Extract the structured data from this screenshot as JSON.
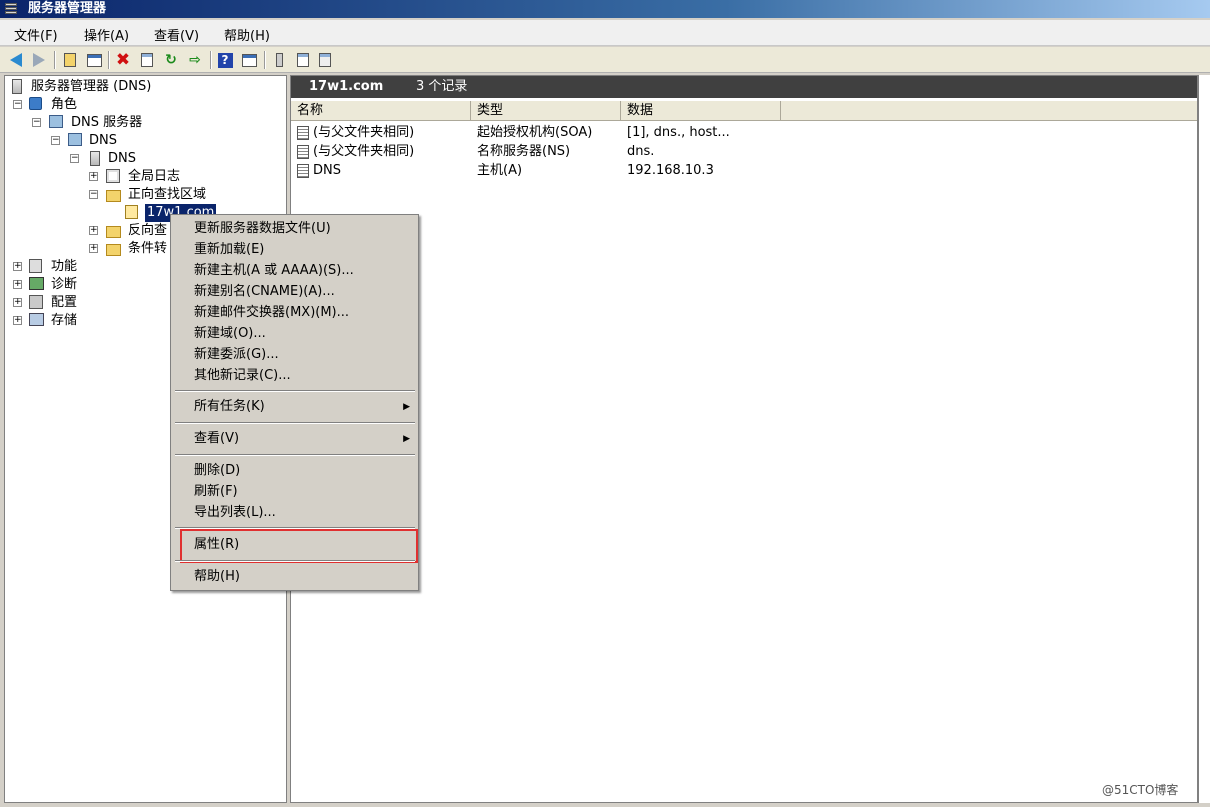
{
  "window": {
    "title": "服务器管理器"
  },
  "menubar": [
    "文件(F)",
    "操作(A)",
    "查看(V)",
    "帮助(H)"
  ],
  "tree": {
    "root": "服务器管理器 (DNS)",
    "roles": "角色",
    "dns_server": "DNS 服务器",
    "dns": "DNS",
    "dns_host": "DNS",
    "global_log": "全局日志",
    "forward_zones": "正向查找区域",
    "zone": "17w1.com",
    "reverse_zones": "反向查",
    "conditional": "条件转",
    "features": "功能",
    "diagnostics": "诊断",
    "configuration": "配置",
    "storage": "存储"
  },
  "content": {
    "zone_name": "17w1.com",
    "record_count": "3 个记录",
    "columns": [
      "名称",
      "类型",
      "数据"
    ],
    "records": [
      {
        "name": "(与父文件夹相同)",
        "type": "起始授权机构(SOA)",
        "data": "[1], dns., host..."
      },
      {
        "name": "(与父文件夹相同)",
        "type": "名称服务器(NS)",
        "data": "dns."
      },
      {
        "name": "DNS",
        "type": "主机(A)",
        "data": "192.168.10.3"
      }
    ]
  },
  "context_menu": {
    "update_file": "更新服务器数据文件(U)",
    "reload": "重新加载(E)",
    "new_host": "新建主机(A 或 AAAA)(S)...",
    "new_alias": "新建别名(CNAME)(A)...",
    "new_mx": "新建邮件交换器(MX)(M)...",
    "new_domain": "新建域(O)...",
    "new_delegation": "新建委派(G)...",
    "other_records": "其他新记录(C)...",
    "all_tasks": "所有任务(K)",
    "view": "查看(V)",
    "delete": "删除(D)",
    "refresh": "刷新(F)",
    "export_list": "导出列表(L)...",
    "properties": "属性(R)",
    "help": "帮助(H)",
    "submenu_arrow": "▶"
  },
  "watermark": "@51CTO博客"
}
